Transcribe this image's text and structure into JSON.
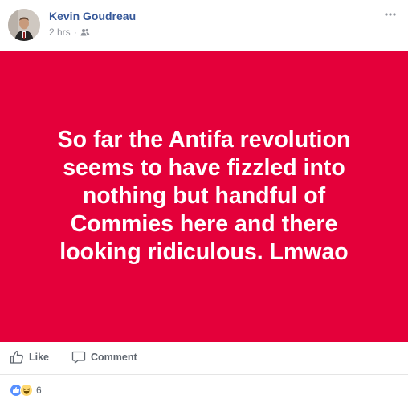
{
  "post": {
    "author": "Kevin Goudreau",
    "time": "2 hrs",
    "audience_icon": "friends-icon",
    "text": "So far the Antifa revolution seems to have fizzled into nothing but handful of Commies here and there looking ridiculous. Lmwao",
    "background_color": "#e4003a"
  },
  "actions": {
    "like_label": "Like",
    "comment_label": "Comment"
  },
  "reactions": {
    "types": [
      "like-icon",
      "haha-icon"
    ],
    "count": "6"
  },
  "colors": {
    "author_link": "#365899",
    "meta_text": "#90949c",
    "action_text": "#606770",
    "like_blue": "#5890ff",
    "haha_yellow": "#ffd972"
  }
}
